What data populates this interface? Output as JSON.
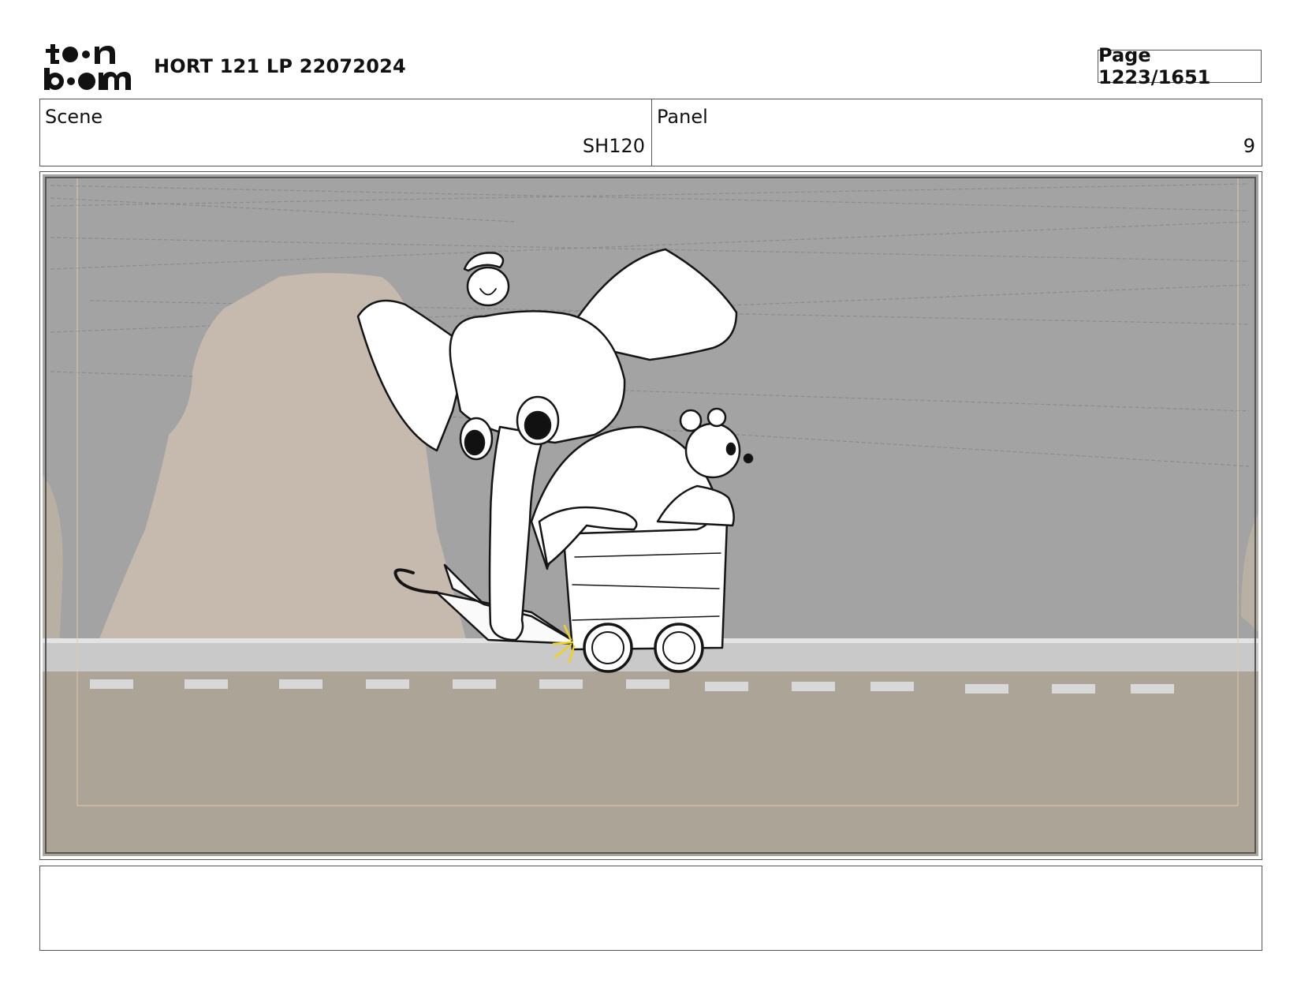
{
  "header": {
    "logo_text": "toon boom",
    "title": "HORT 121 LP 22072024",
    "page_label": "Page 1223/1651"
  },
  "meta": {
    "scene_label": "Scene",
    "scene_value": "SH120",
    "panel_label": "Panel",
    "panel_value": "9"
  },
  "notes": {
    "text": ""
  }
}
